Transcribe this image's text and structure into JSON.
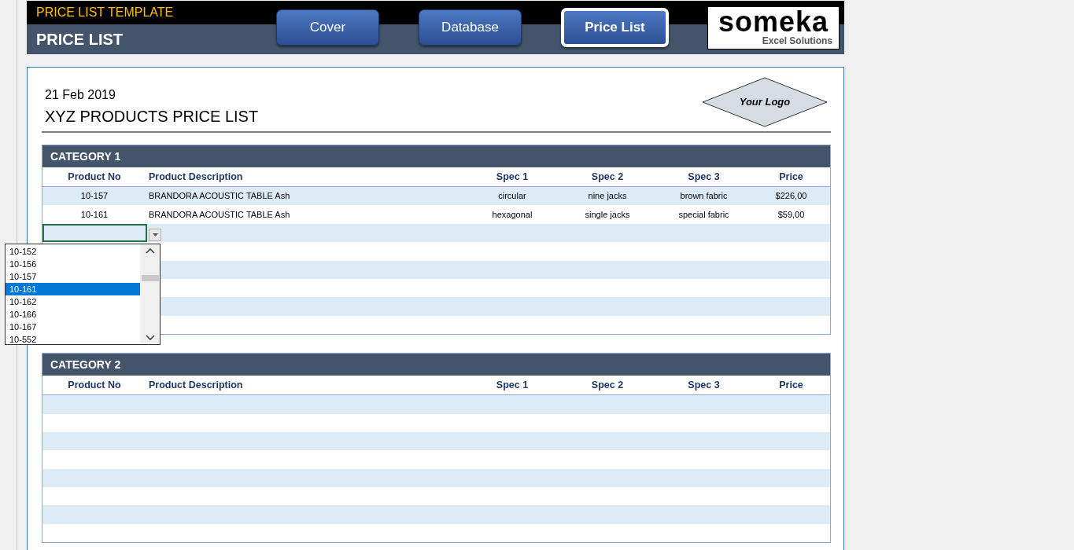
{
  "header": {
    "template_title": "PRICE LIST TEMPLATE",
    "page_title": "PRICE LIST",
    "nav": [
      {
        "label": "Cover",
        "selected": false
      },
      {
        "label": "Database",
        "selected": false
      },
      {
        "label": "Price List",
        "selected": true
      }
    ],
    "brand": {
      "name": "someka",
      "tagline": "Excel Solutions"
    }
  },
  "sheet": {
    "date": "21 Feb 2019",
    "title": "XYZ PRODUCTS PRICE LIST",
    "logo_placeholder": "Your Logo"
  },
  "categories": [
    {
      "title": "CATEGORY 1",
      "columns": [
        "Product No",
        "Product Description",
        "Spec 1",
        "Spec 2",
        "Spec 3",
        "Price"
      ],
      "rows": [
        [
          "10-157",
          "BRANDORA ACOUSTIC TABLE Ash",
          "circular",
          "nine jacks",
          "brown fabric",
          "$226,00"
        ],
        [
          "10-161",
          "BRANDORA ACOUSTIC TABLE Ash",
          "hexagonal",
          "single jacks",
          "special fabric",
          "$59,00"
        ]
      ],
      "dropdown": {
        "items": [
          {
            "label": "10-152",
            "selected": false
          },
          {
            "label": "10-156",
            "selected": false
          },
          {
            "label": "10-157",
            "selected": false
          },
          {
            "label": "10-161",
            "selected": true
          },
          {
            "label": "10-162",
            "selected": false
          },
          {
            "label": "10-166",
            "selected": false
          },
          {
            "label": "10-167",
            "selected": false
          },
          {
            "label": "10-552",
            "selected": false
          }
        ]
      }
    },
    {
      "title": "CATEGORY 2",
      "columns": [
        "Product No",
        "Product Description",
        "Spec 1",
        "Spec 2",
        "Spec 3",
        "Price"
      ]
    }
  ]
}
